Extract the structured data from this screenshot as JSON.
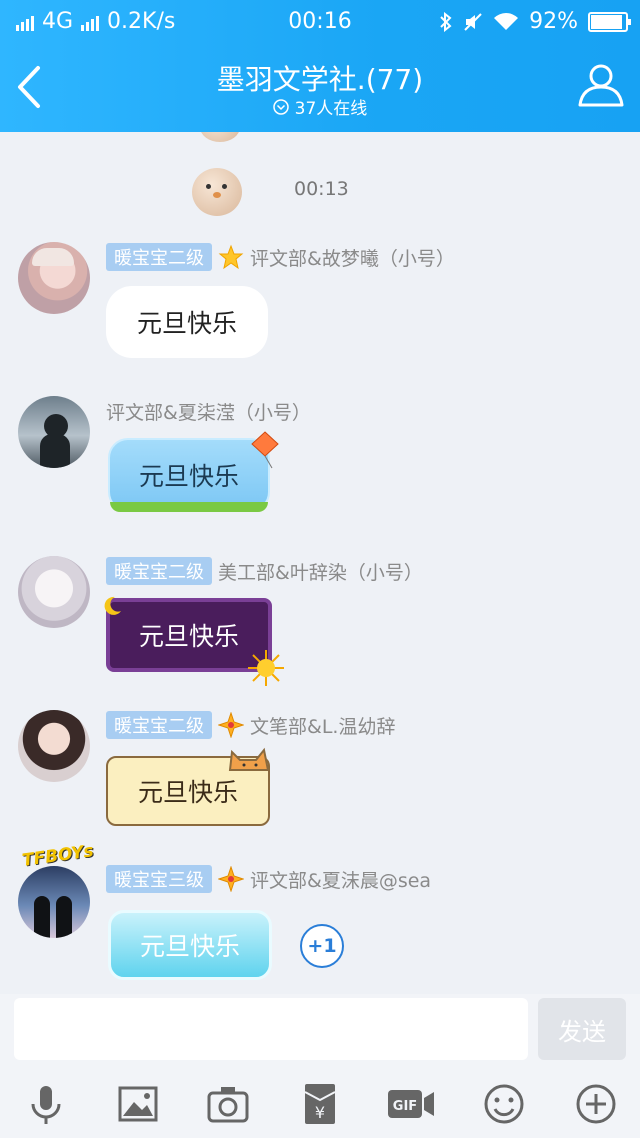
{
  "status_bar": {
    "network": "4G",
    "speed": "0.2K/s",
    "time": "00:16",
    "battery": "92%",
    "battery_level": 0.92
  },
  "header": {
    "title": "墨羽文学社.(77)",
    "online": "37人在线"
  },
  "chat": {
    "timestamp": "00:13",
    "messages": [
      {
        "badge": "暖宝宝二级",
        "name": "评文部&故梦曦（小号）",
        "text": "元旦快乐",
        "bubble_style": "white"
      },
      {
        "badge": "",
        "name": "评文部&夏柒滢（小号）",
        "text": "元旦快乐",
        "bubble_style": "sky-kite"
      },
      {
        "badge": "暖宝宝二级",
        "name": "美工部&叶辞染（小号）",
        "text": "元旦快乐",
        "bubble_style": "purple-moon-sun"
      },
      {
        "badge": "暖宝宝二级",
        "name": "文笔部&L.温幼辞",
        "text": "元旦快乐",
        "bubble_style": "cat"
      },
      {
        "badge": "暖宝宝三级",
        "name": "评文部&夏沫晨@sea",
        "text": "元旦快乐",
        "bubble_style": "cyan",
        "avatar_label": "TFBOYs"
      }
    ],
    "plus_one": "+1"
  },
  "composer": {
    "input_value": "",
    "send_label": "发送"
  },
  "toolbar": {
    "items": [
      "mic-icon",
      "image-icon",
      "camera-icon",
      "red-packet-icon",
      "gif-icon",
      "emoji-icon",
      "plus-icon"
    ]
  },
  "colors": {
    "header": "#1aa6f5",
    "badge": "#a8cdf2",
    "background": "#eef1f6"
  }
}
